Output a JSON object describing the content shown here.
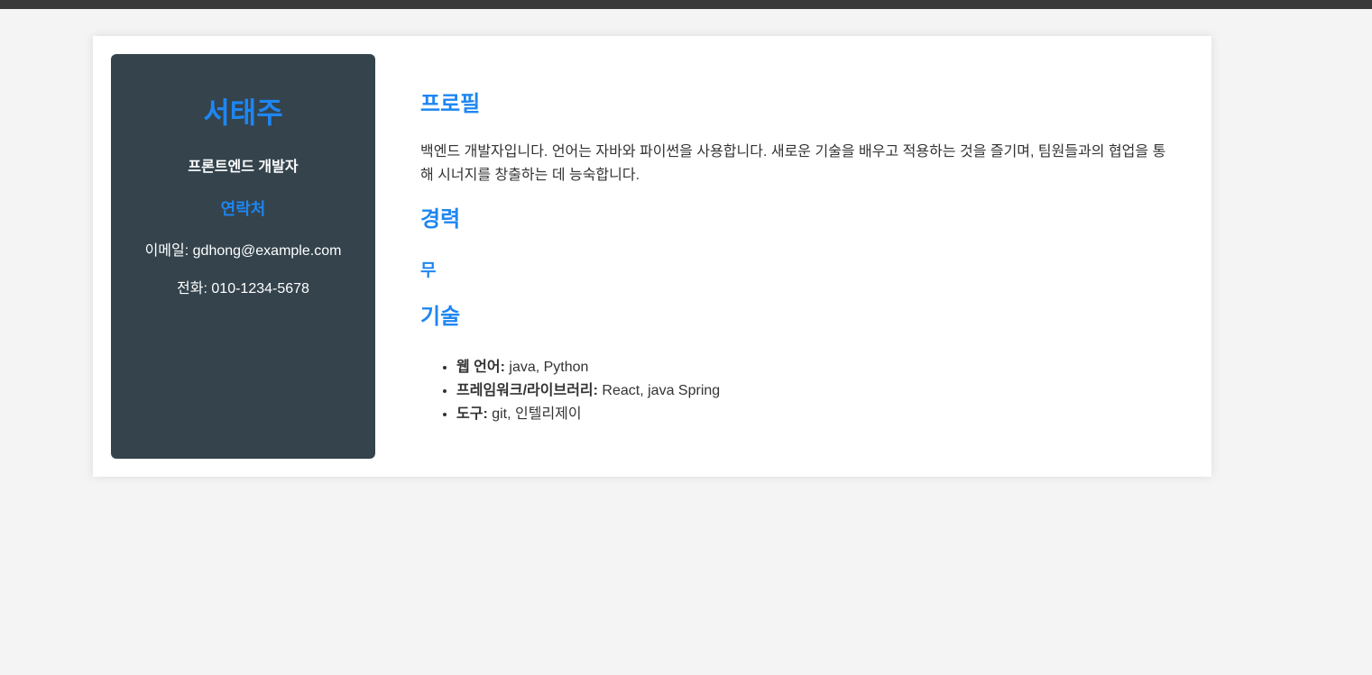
{
  "sidebar": {
    "name": "서태주",
    "role": "프론트엔드 개발자",
    "contact_title": "연락처",
    "email_label": "이메일: ",
    "email": "gdhong@example.com",
    "phone_label": "전화: ",
    "phone": "010-1234-5678"
  },
  "main": {
    "profile_title": "프로필",
    "profile_text": "백엔드 개발자입니다. 언어는 자바와 파이썬을 사용합니다. 새로운 기술을 배우고 적용하는 것을 즐기며, 팀원들과의 협업을 통해 시너지를 창출하는 데 능숙합니다.",
    "experience_title": "경력",
    "experience_item": "무",
    "skills_title": "기술",
    "skills": [
      {
        "label": "웹 언어:",
        "value": " java, Python"
      },
      {
        "label": "프레임워크/라이브러리:",
        "value": " React, java Spring"
      },
      {
        "label": "도구:",
        "value": " git, 인텔리제이"
      }
    ]
  },
  "colors": {
    "accent": "#1e86f2",
    "sidebar_bg": "#34434c",
    "page_bg": "#f4f4f4",
    "topbar": "#3a3a3a"
  }
}
